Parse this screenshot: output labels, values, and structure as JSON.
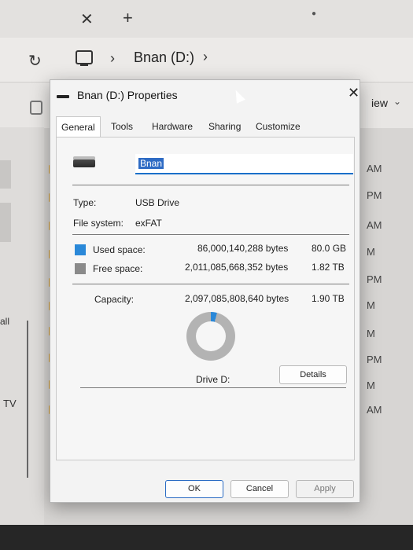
{
  "explorer": {
    "tab_close": "✕",
    "tab_new": "+",
    "refresh": "↻",
    "breadcrumb_sep1": "›",
    "breadcrumb_location": "Bnan (D:)",
    "breadcrumb_sep2": "›",
    "view_label": "iew",
    "left_items": [
      "all",
      "TV"
    ],
    "times": [
      "AM",
      "PM",
      "AM",
      "M",
      "PM",
      "M",
      "M",
      "PM",
      "M",
      "AM"
    ]
  },
  "dialog": {
    "title": "Bnan (D:) Properties",
    "close_label": "✕",
    "tabs": [
      "General",
      "Tools",
      "Hardware",
      "Sharing",
      "Customize"
    ],
    "active_tab": "General",
    "drive_name": "Bnan",
    "type_label": "Type:",
    "type_value": "USB Drive",
    "fs_label": "File system:",
    "fs_value": "exFAT",
    "used_label": "Used space:",
    "used_bytes": "86,000,140,288 bytes",
    "used_human": "80.0 GB",
    "free_label": "Free space:",
    "free_bytes": "2,011,085,668,352 bytes",
    "free_human": "1.82 TB",
    "capacity_label": "Capacity:",
    "capacity_bytes": "2,097,085,808,640 bytes",
    "capacity_human": "1.90 TB",
    "drive_caption": "Drive D:",
    "details_button": "Details",
    "ok_button": "OK",
    "cancel_button": "Cancel",
    "apply_button": "Apply",
    "used_fraction": 0.041,
    "colors": {
      "used": "#2a88d8",
      "free": "#8a8a8a",
      "accent": "#1a6fc9"
    }
  }
}
